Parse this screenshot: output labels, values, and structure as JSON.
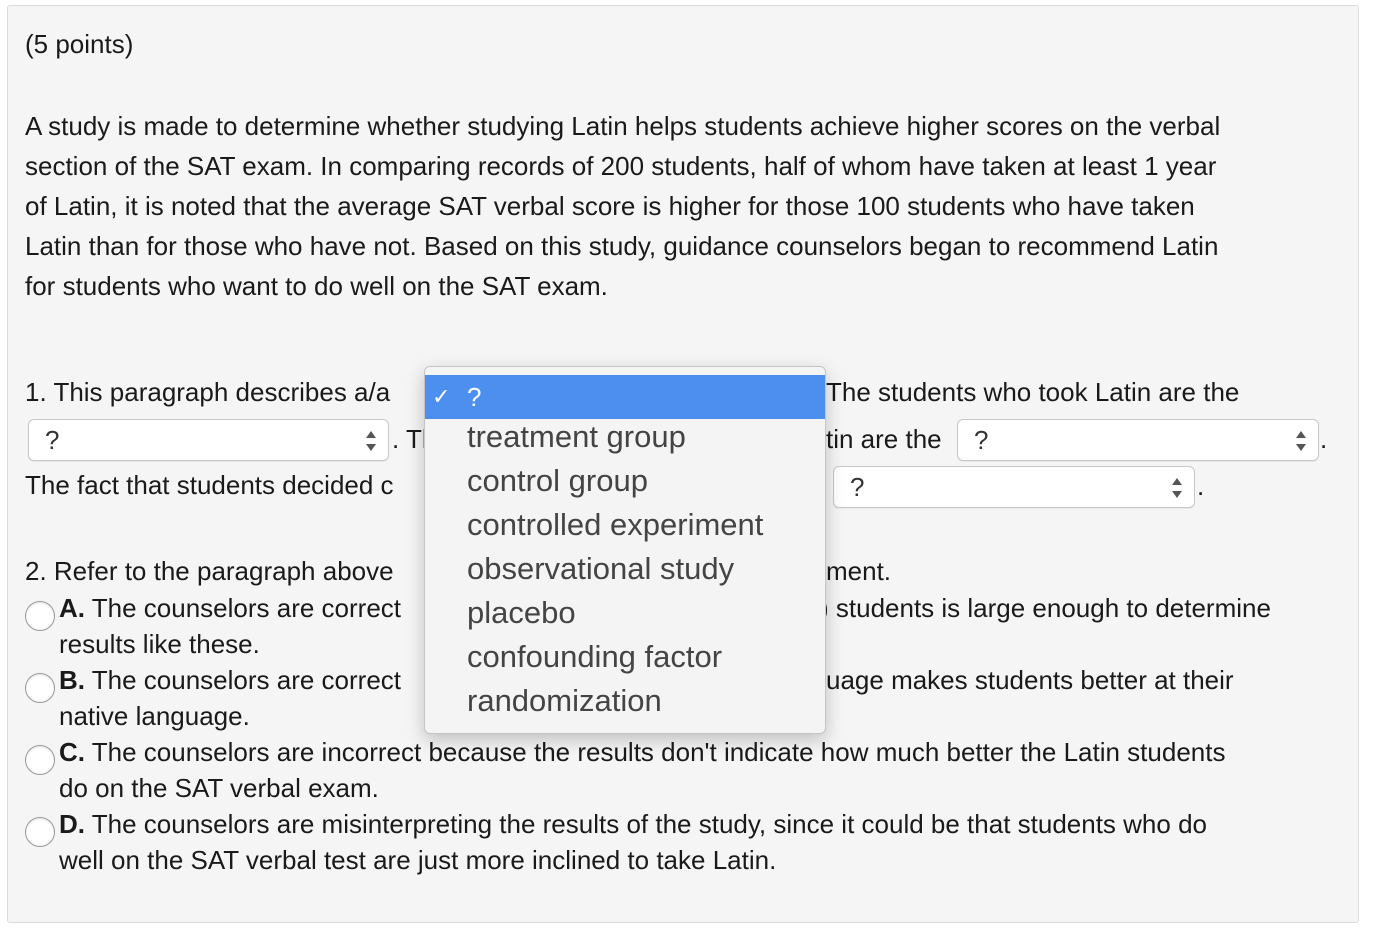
{
  "question": {
    "points": "(5 points)",
    "paragraph_lines": [
      "A study is made to determine whether studying Latin helps students achieve higher scores on the verbal",
      "section of the SAT exam. In comparing records of 200 students, half of whom have taken at least 1 year",
      "of Latin, it is noted that the average SAT verbal score is higher for those 100 students who have taken",
      "Latin than for those who have not. Based on this study, guidance counselors began to recommend Latin",
      "for students who want to do well on the SAT exam."
    ]
  },
  "part1": {
    "line1_start": "1. This paragraph describes a/a",
    "line1_end": "The students who took Latin are the",
    "line2_mid_left": ". Th",
    "line2_mid_right": "tin are the",
    "line2_end": ".",
    "line3_start": "The fact that students decided c",
    "line3_end": ".",
    "selects": {
      "select_a": "?",
      "select_b": "?",
      "select_c": "?"
    }
  },
  "part2": {
    "prompt_start": "2. Refer to the paragraph above",
    "prompt_end": "ment.",
    "options": [
      {
        "letter": "A.",
        "line1_start": " The counselors are correct",
        "line1_end": ") students is large enough to determine",
        "line2": "results like these."
      },
      {
        "letter": "B.",
        "line1_start": " The counselors are correct",
        "line1_end": "uage makes students better at their",
        "line2": "native language."
      },
      {
        "letter": "C.",
        "line1": " The counselors are incorrect because the results don't indicate how much better the Latin students",
        "line2": "do on the SAT verbal exam."
      },
      {
        "letter": "D.",
        "line1": " The counselors are misinterpreting the results of the study, since it could be that students who do",
        "line2": "well on the SAT verbal test are just more inclined to take Latin."
      }
    ]
  },
  "dropdown": {
    "selected": "?",
    "check_glyph": "✓",
    "items": [
      "treatment group",
      "control group",
      "controlled experiment",
      "observational study",
      "placebo",
      "confounding factor",
      "randomization"
    ]
  },
  "colors": {
    "highlight": "#4c8fef",
    "panel": "#f5f5f5"
  }
}
